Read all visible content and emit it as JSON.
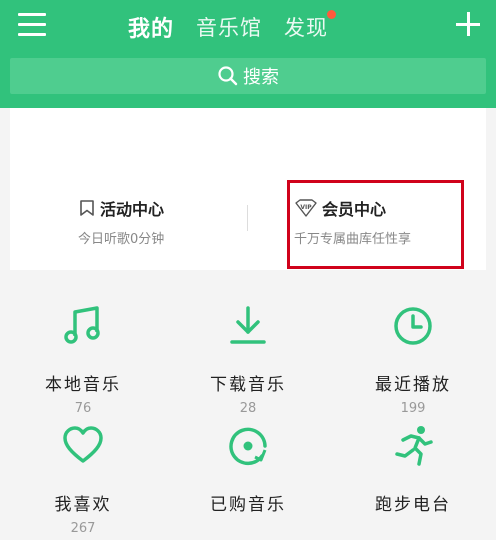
{
  "header": {
    "tabs": [
      {
        "label": "我的",
        "active": true
      },
      {
        "label": "音乐馆",
        "active": false
      },
      {
        "label": "发现",
        "active": false,
        "badge": true
      }
    ],
    "search_label": "搜索"
  },
  "card": {
    "items": [
      {
        "title": "活动中心",
        "subtitle": "今日听歌0分钟",
        "icon": "bookmark-icon"
      },
      {
        "title": "会员中心",
        "subtitle": "千万专属曲库任性享",
        "icon": "vip-icon"
      }
    ]
  },
  "grid": {
    "items": [
      {
        "label": "本地音乐",
        "count": "76",
        "icon": "music-note-icon"
      },
      {
        "label": "下载音乐",
        "count": "28",
        "icon": "download-icon"
      },
      {
        "label": "最近播放",
        "count": "199",
        "icon": "clock-icon"
      },
      {
        "label": "我喜欢",
        "count": "267",
        "icon": "heart-icon"
      },
      {
        "label": "已购音乐",
        "count": "",
        "icon": "disc-icon"
      },
      {
        "label": "跑步电台",
        "count": "",
        "icon": "running-icon"
      }
    ]
  },
  "colors": {
    "accent": "#31c27c",
    "badge": "#ff5a3c",
    "highlight": "#d0021b"
  }
}
